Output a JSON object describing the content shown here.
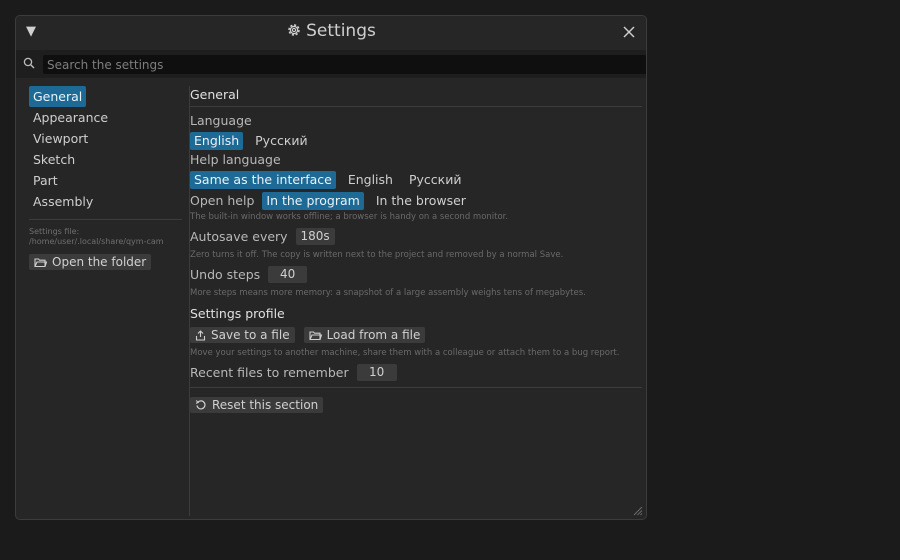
{
  "window": {
    "title": "Settings"
  },
  "search": {
    "placeholder": "Search the settings"
  },
  "sidebar": {
    "items": [
      {
        "label": "General",
        "active": true
      },
      {
        "label": "Appearance",
        "active": false
      },
      {
        "label": "Viewport",
        "active": false
      },
      {
        "label": "Sketch",
        "active": false
      },
      {
        "label": "Part",
        "active": false
      },
      {
        "label": "Assembly",
        "active": false
      }
    ],
    "settings_file_label": "Settings file:",
    "settings_file_path": "/home/user/.local/share/qym-cam",
    "open_folder_label": "Open the folder"
  },
  "general": {
    "section_title": "General",
    "language": {
      "label": "Language",
      "options": [
        "English",
        "Русский"
      ],
      "selected": "English"
    },
    "help_language": {
      "label": "Help language",
      "options": [
        "Same as the interface",
        "English",
        "Русский"
      ],
      "selected": "Same as the interface"
    },
    "open_help": {
      "label": "Open help",
      "options": [
        "In the program",
        "In the browser"
      ],
      "selected": "In the program",
      "hint": "The built-in window works offline; a browser is handy on a second monitor."
    },
    "autosave": {
      "label": "Autosave every",
      "value": "180s",
      "hint": "Zero turns it off. The copy is written next to the project and removed by a normal Save."
    },
    "undo_steps": {
      "label": "Undo steps",
      "value": "40",
      "hint": "More steps means more memory: a snapshot of a large assembly weighs tens of megabytes."
    },
    "profile": {
      "title": "Settings profile",
      "save_label": "Save to a file",
      "load_label": "Load from a file",
      "hint": "Move your settings to another machine, share them with a colleague or attach them to a bug report."
    },
    "recent_files": {
      "label": "Recent files to remember",
      "value": "10"
    },
    "reset_label": "Reset this section"
  },
  "colors": {
    "accent": "#1c6a95",
    "background": "#262626",
    "page_background": "#1b1b1b"
  },
  "icons": {
    "collapse": "triangle-down-icon",
    "title": "gear-icon",
    "close": "close-icon",
    "search": "search-icon",
    "folder": "folder-open-icon",
    "share": "share-icon",
    "reset": "reset-icon",
    "resize": "resize-grip-icon"
  }
}
